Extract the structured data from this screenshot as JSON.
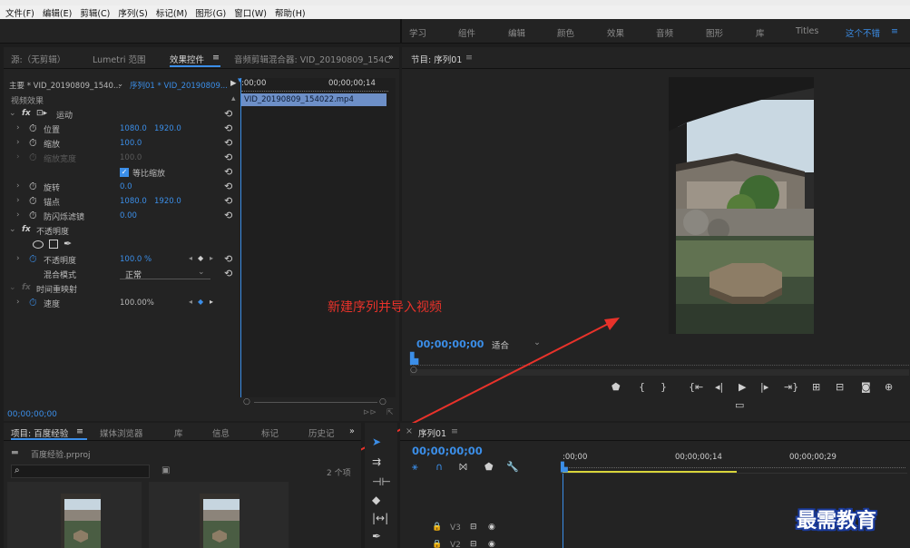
{
  "menu": [
    "文件(F)",
    "编辑(E)",
    "剪辑(C)",
    "序列(S)",
    "标记(M)",
    "图形(G)",
    "窗口(W)",
    "帮助(H)"
  ],
  "workspaces": [
    "学习",
    "组件",
    "编辑",
    "颜色",
    "效果",
    "音频",
    "图形",
    "库",
    "Titles",
    "这个不错"
  ],
  "workspace_menu_icon": "≡",
  "effect_panel": {
    "tabs": [
      "源:（无剪辑）",
      "Lumetri 范围",
      "效果控件",
      "音频剪辑混合器: VID_20190809_154C"
    ],
    "active_tab_suffix": "≡",
    "more": "»",
    "master_label": "主要 * VID_20190809_1540...",
    "sequence_label": "序列01 * VID_20190809...",
    "timeline_start": ":00;00",
    "timeline_end": "00;00;00;14",
    "clip_name": "VID_20190809_154022.mp4",
    "video_effects": "视频效果",
    "motion": "运动",
    "position": "位置",
    "position_x": "1080.0",
    "position_y": "1920.0",
    "scale": "缩放",
    "scale_val": "100.0",
    "scale_width": "缩放宽度",
    "scale_width_val": "100.0",
    "uniform_scale": "等比缩放",
    "rotation": "旋转",
    "rotation_val": "0.0",
    "anchor": "锚点",
    "anchor_x": "1080.0",
    "anchor_y": "1920.0",
    "anti_flicker": "防闪烁滤镜",
    "anti_flicker_val": "0.00",
    "opacity_group": "不透明度",
    "opacity": "不透明度",
    "opacity_val": "100.0 %",
    "blend_mode": "混合模式",
    "blend_val": "正常",
    "time_remap": "时间重映射",
    "speed": "速度",
    "speed_val": "100.00%",
    "bottom_tc": "00;00;00;00"
  },
  "program": {
    "title": "节目: 序列01",
    "menu_icon": "≡",
    "timecode": "00;00;00;00",
    "fit": "适合"
  },
  "annotation": "新建序列并导入视频",
  "project": {
    "tabs": [
      "项目: 百度经验",
      "媒体浏览器",
      "库",
      "信息",
      "标记",
      "历史记"
    ],
    "menu_icon": "≡",
    "more": "»",
    "file": "百度经验.prproj",
    "count": "2 个项"
  },
  "timeline": {
    "tab": "序列01",
    "menu_icon": "≡",
    "close": "×",
    "timecode": "00;00;00;00",
    "ruler": [
      ":00;00",
      "00;00;00;14",
      "00;00;00;29"
    ],
    "tracks": [
      "V3",
      "V2"
    ]
  },
  "watermark": "最需教育",
  "colors": {
    "accent": "#3b8ee8",
    "annotation": "#e8322a"
  }
}
